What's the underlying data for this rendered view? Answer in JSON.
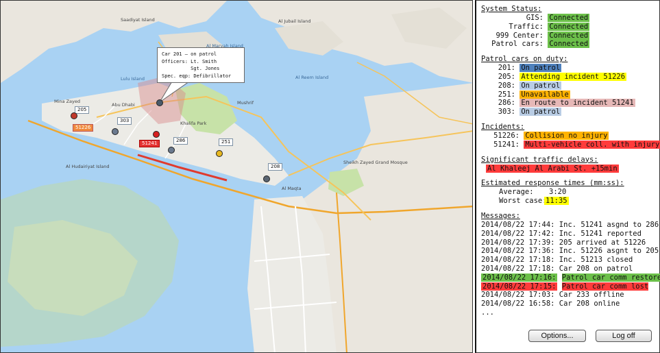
{
  "map": {
    "callout": "Car 201 – on patrol\nOfficers: Lt. Smith\n          Sgt. Jones\nSpec. eqp: Defibrillator",
    "markers": [
      {
        "id": "205",
        "color": "#c0392b"
      },
      {
        "id": "51226",
        "color": "#e05a2a"
      },
      {
        "id": "303",
        "color": "#6b7a8f"
      },
      {
        "id": "51241",
        "color": "#d62020"
      },
      {
        "id": "286",
        "color": "#6b7a8f"
      },
      {
        "id": "251",
        "color": "#e8b820"
      },
      {
        "id": "208",
        "color": "#5a6572"
      },
      {
        "id": "201",
        "color": "#4a5a6a"
      }
    ],
    "places": [
      "Abu Dhabi",
      "Al Hudairiyat Island",
      "Saadiyat Island",
      "Al Jubail Island",
      "Mina Zayed",
      "Al Maqta",
      "Khalifa Park",
      "Mushrif",
      "Al Maryah Island",
      "Al Reem Island",
      "Lulu Island",
      "Sheikh Zayed Grand Mosque"
    ]
  },
  "status": {
    "heading": "System Status:",
    "items": [
      {
        "label": "GIS:",
        "value": "Connected"
      },
      {
        "label": "Traffic:",
        "value": "Connected"
      },
      {
        "label": "999 Center:",
        "value": "Connected"
      },
      {
        "label": "Patrol cars:",
        "value": "Connected"
      }
    ]
  },
  "patrol": {
    "heading": "Patrol cars on duty:",
    "items": [
      {
        "id": "201:",
        "value": "On patrol",
        "style": "b"
      },
      {
        "id": "205:",
        "value": "Attending incident 51226",
        "style": "y"
      },
      {
        "id": "208:",
        "value": "On patrol",
        "style": "lb"
      },
      {
        "id": "251:",
        "value": "Unavailable",
        "style": "o"
      },
      {
        "id": "286:",
        "value": "En route to incident 51241",
        "style": "p"
      },
      {
        "id": "303:",
        "value": "On patrol",
        "style": "lb"
      }
    ]
  },
  "incidents": {
    "heading": "Incidents:",
    "items": [
      {
        "id": "51226:",
        "value": "Collision no injury",
        "style": "o"
      },
      {
        "id": "51241:",
        "value": "Multi-vehicle coll. with injury",
        "style": "r"
      }
    ]
  },
  "traffic": {
    "heading": "Significant traffic delays:",
    "value": "Al Khaleej Al Arabi St. +15min"
  },
  "response": {
    "heading": "Estimated response times (mm:ss):",
    "average_label": "Average:",
    "average": "3:20",
    "worst_label": "Worst case:",
    "worst": "11:35"
  },
  "messages": {
    "heading": "Messages:",
    "items": [
      {
        "ts": "2014/08/22 17:44:",
        "text": "Inc. 51241 asgnd to 286",
        "style": ""
      },
      {
        "ts": "2014/08/22 17:42:",
        "text": "Inc. 51241 reported",
        "style": ""
      },
      {
        "ts": "2014/08/22 17:39:",
        "text": "205 arrived at 51226",
        "style": ""
      },
      {
        "ts": "2014/08/22 17:36:",
        "text": "Inc. 51226 asgnt to 205",
        "style": ""
      },
      {
        "ts": "2014/08/22 17:18:",
        "text": "Inc. 51213 closed",
        "style": ""
      },
      {
        "ts": "2014/08/22 17:18:",
        "text": "Car 208 on patrol",
        "style": ""
      },
      {
        "ts": "2014/08/22 17:16:",
        "text": "Patrol car comm restored",
        "style": "g"
      },
      {
        "ts": "2014/08/22 17:15:",
        "text": "Patrol car comm lost",
        "style": "r"
      },
      {
        "ts": "2014/08/22 17:03:",
        "text": "Car 233 offline",
        "style": ""
      },
      {
        "ts": "2014/08/22 16:58:",
        "text": "Car 208 online",
        "style": ""
      }
    ],
    "more": "..."
  },
  "buttons": {
    "options": "Options...",
    "logoff": "Log off"
  }
}
